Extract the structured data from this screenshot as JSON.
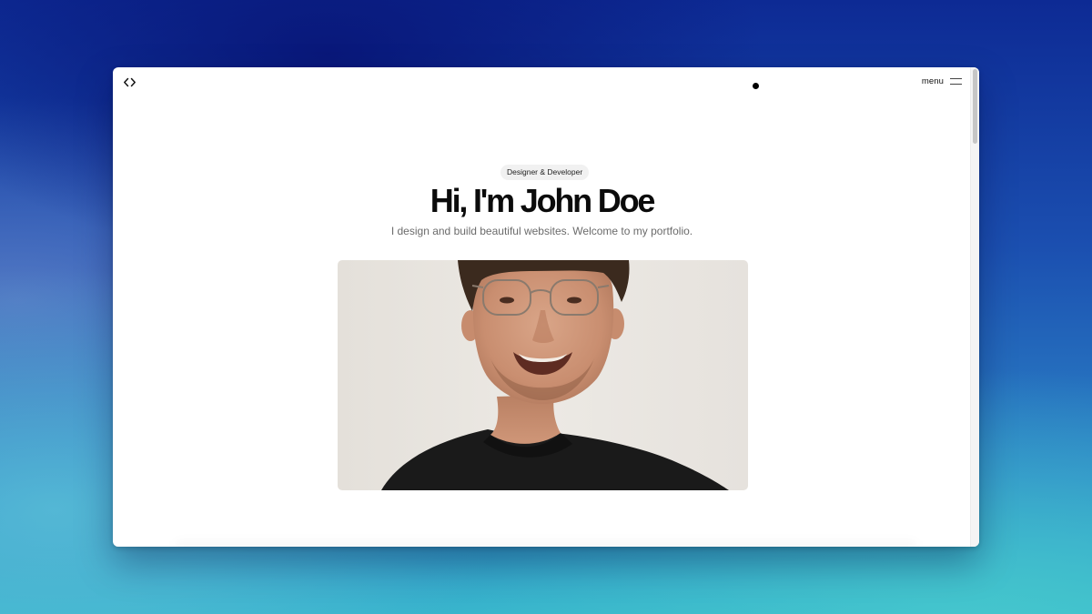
{
  "nav": {
    "logo_icon": "code-brackets-icon",
    "menu_label": "menu",
    "menu_icon": "hamburger-icon"
  },
  "hero": {
    "badge": "Designer & Developer",
    "title": "Hi, I'm John Doe",
    "subtitle": "I design and build beautiful websites. Welcome to my portfolio."
  },
  "colors": {
    "title": "#0b0b0b",
    "subtitle": "#6b6b6b",
    "badge_bg": "#f1f1f1",
    "photo_bg": "#e9e6e1"
  }
}
